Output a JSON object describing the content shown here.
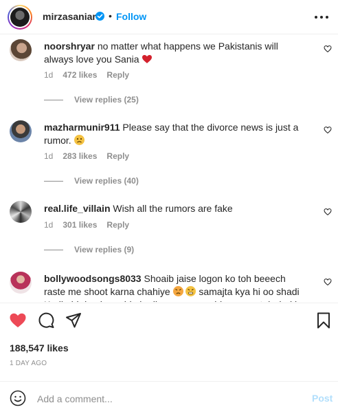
{
  "header": {
    "username": "mirzasaniar",
    "separator": "•",
    "follow_label": "Follow",
    "verified_color": "#0095f6",
    "more_icon": "more-horizontal-icon"
  },
  "comments": [
    {
      "username": "noorshryar",
      "text": "no matter what happens we Pakistanis will always love you Sania",
      "emoji": "red-heart",
      "time": "1d",
      "likes": "472 likes",
      "reply_label": "Reply",
      "view_replies": "View replies (25)"
    },
    {
      "username": "mazharmunir911",
      "text": "Please say that the divorce news is just a rumor.",
      "emoji": "worried-face",
      "time": "1d",
      "likes": "283 likes",
      "reply_label": "Reply",
      "view_replies": "View replies (40)"
    },
    {
      "username": "real.life_villain",
      "text": "Wish all the rumors are fake",
      "time": "1d",
      "likes": "301 likes",
      "reply_label": "Reply",
      "view_replies": "View replies (9)"
    },
    {
      "username": "bollywoodsongs8033",
      "text_part1": "Shoaib jaise logon ko toh beeech raste me shoot karna chahiye",
      "text_part2": "samajta kya hi oo shadi Karli phir bache paida karliye uses man bhar gaya toh duri ke dhunli",
      "emojis": [
        "angry-face",
        "angry-face"
      ]
    }
  ],
  "actions": {
    "like_icon": "heart-filled-icon",
    "comment_icon": "comment-icon",
    "share_icon": "share-icon",
    "save_icon": "bookmark-icon",
    "like_color": "#ed4956"
  },
  "likes_count": "188,547 likes",
  "posted_time": "1 DAY AGO",
  "add_comment": {
    "placeholder": "Add a comment...",
    "post_label": "Post",
    "post_color": "#b2dffc"
  }
}
